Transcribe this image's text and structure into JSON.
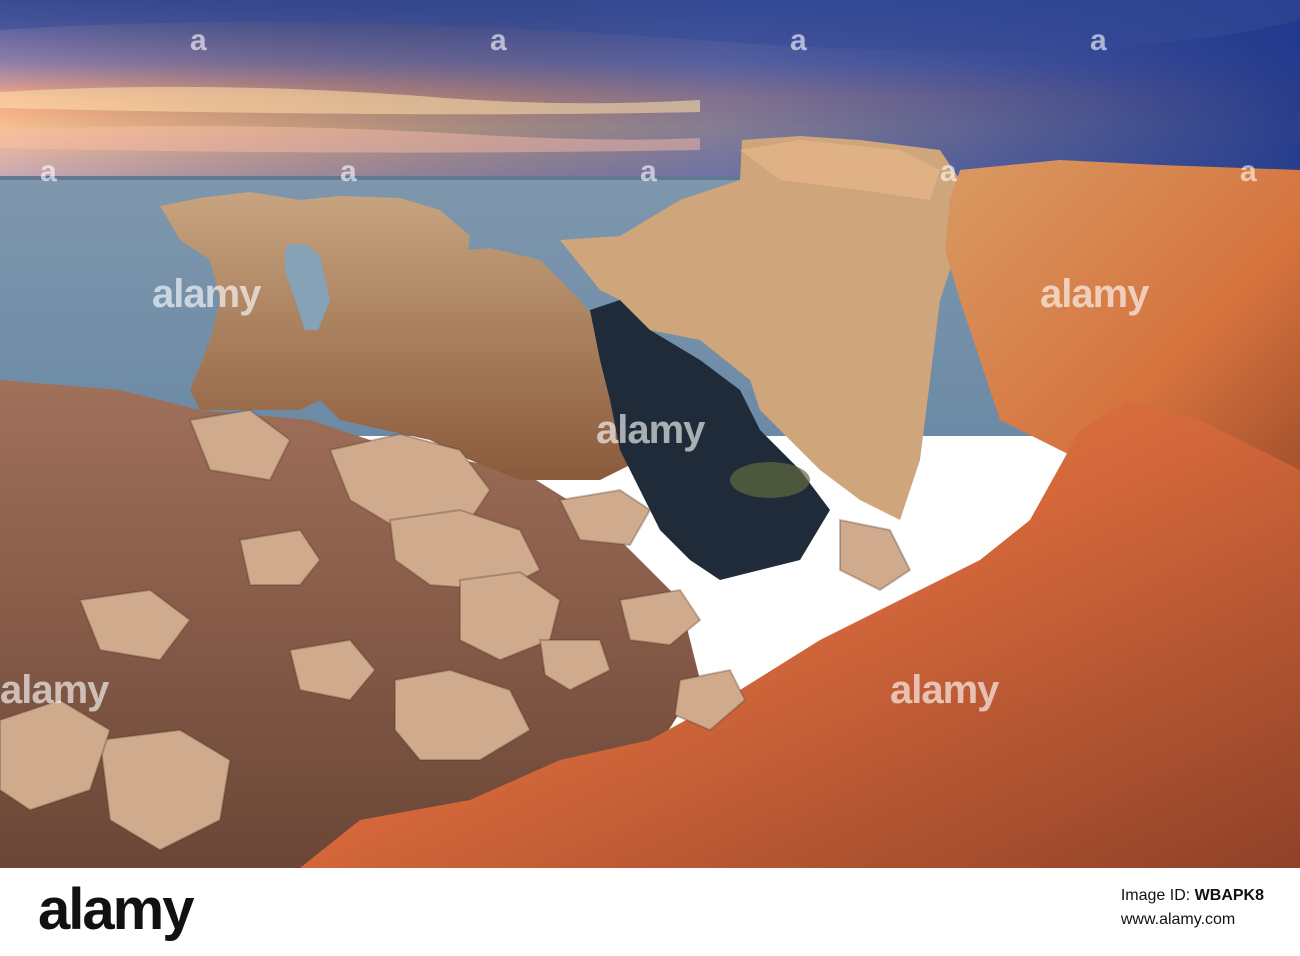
{
  "watermark": {
    "text": "alamy",
    "small_mark": "a"
  },
  "footer": {
    "logo": "alamy",
    "image_id_label": "Image ID:",
    "image_id": "WBAPK8",
    "site": "www.alamy.com"
  },
  "colors": {
    "sky_top": "#3c5aa4",
    "sunset": "#f7b87d",
    "sea": "#7c9bb5",
    "rock": "#c98a57",
    "rock_lit": "#e0703d",
    "pool": "#1d2935"
  }
}
